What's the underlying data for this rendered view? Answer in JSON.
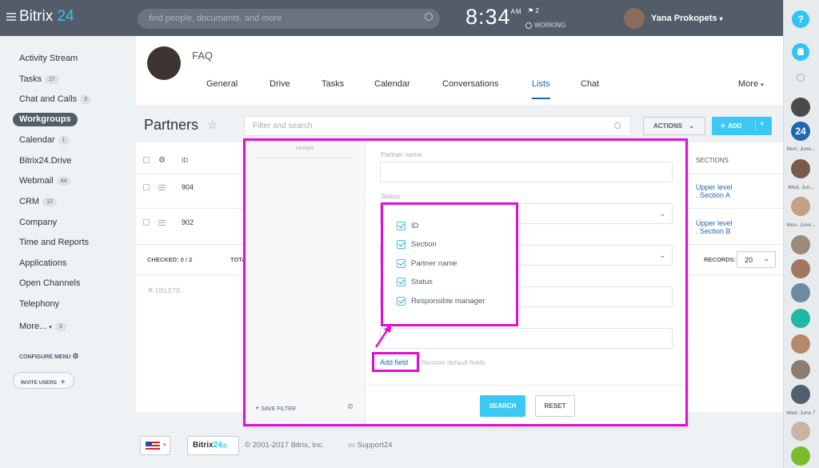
{
  "header": {
    "brand_main": "Bitrix",
    "brand_num": " 24",
    "search_placeholder": "find people, documents, and more",
    "time": "8:34",
    "ampm": "AM",
    "flag_count": "2",
    "status": "WORKING",
    "user_name": "Yana Prokopets",
    "user_chevron": "▾"
  },
  "sidebar": {
    "items": [
      {
        "label": "Activity Stream",
        "count": ""
      },
      {
        "label": "Tasks",
        "count": "27"
      },
      {
        "label": "Chat and Calls",
        "count": "3"
      },
      {
        "label": "Workgroups",
        "count": ""
      },
      {
        "label": "Calendar",
        "count": "1"
      },
      {
        "label": "Bitrix24.Drive",
        "count": ""
      },
      {
        "label": "Webmail",
        "count": "44"
      },
      {
        "label": "CRM",
        "count": "12"
      },
      {
        "label": "Company",
        "count": ""
      },
      {
        "label": "Time and Reports",
        "count": ""
      },
      {
        "label": "Applications",
        "count": ""
      },
      {
        "label": "Open Channels",
        "count": ""
      },
      {
        "label": "Telephony",
        "count": ""
      },
      {
        "label": "More...",
        "count": "3"
      }
    ],
    "configure": "CONFIGURE MENU",
    "invite": "INVITE USERS"
  },
  "group": {
    "title": "FAQ",
    "tabs": [
      "General",
      "Drive",
      "Tasks",
      "Calendar",
      "Conversations",
      "Lists",
      "Chat",
      "More"
    ],
    "active_tab": "Lists"
  },
  "page": {
    "title": "Partners",
    "filter_placeholder": "Filter and search",
    "actions_label": "ACTIONS",
    "add_label": "ADD"
  },
  "grid": {
    "col_id": "ID",
    "col_sections": "SECTIONS",
    "rows": [
      {
        "id": "904",
        "section_1": "Upper level",
        "section_2": ". Section A"
      },
      {
        "id": "902",
        "section_1": "Upper level",
        "section_2": ". Section B"
      }
    ],
    "checked_label": "CHECKED:",
    "checked_value": "0 / 2",
    "total_label": "TOTA",
    "records_label": "RECORDS:",
    "records_value": "20",
    "delete_label": "DELETE"
  },
  "filter_popup": {
    "filters_title": "FILTERS",
    "save_filter": "SAVE FILTER",
    "fields": [
      {
        "label": "Partner name"
      },
      {
        "label": "Status"
      }
    ],
    "field_options": [
      "ID",
      "Section",
      "Partner name",
      "Status",
      "Responsible manager"
    ],
    "add_field": "Add field",
    "restore": "Restore default fields",
    "search_btn": "SEARCH",
    "reset_btn": "RESET"
  },
  "right_panel": {
    "help": "?",
    "dates": [
      "Mon, June...",
      "Wed, Jun...",
      "Mon, June...",
      "Wed, June 7"
    ],
    "badge": "24"
  },
  "footer": {
    "logo_main": "Bitrix",
    "logo_num": "24",
    "copyright": "© 2001-2017 Bitrix, Inc.",
    "support": "Support24"
  },
  "colors": {
    "accent": "#2fc6f6",
    "topbar": "#535c69",
    "highlight": "#e10fd4",
    "link": "#2067b0"
  }
}
